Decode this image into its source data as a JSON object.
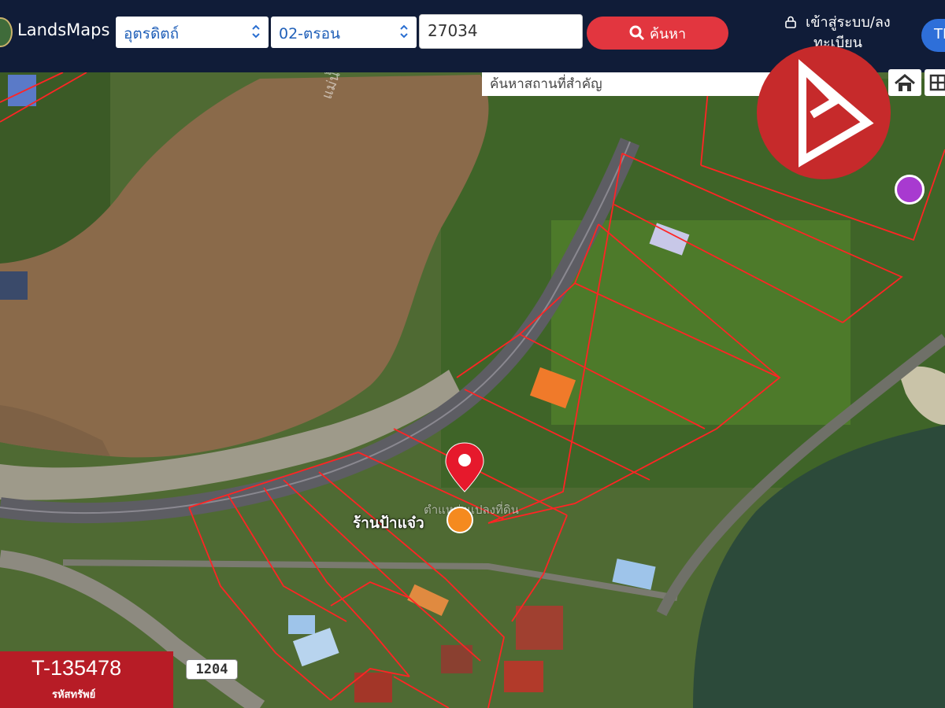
{
  "header": {
    "brand": "LandsMaps",
    "province": "อุตรดิตถ์",
    "district": "02-ตรอน",
    "parcel_number": "27034",
    "search_label": "ค้นหา",
    "login_label": "เข้าสู่ระบบ/ลงทะเบียน",
    "lang_label": "TH"
  },
  "map": {
    "poi_search_placeholder": "ค้นหาสถานที่สำคัญ",
    "clear_label": "×",
    "shop_label": "ร้านป้าแจ๋ว",
    "shop_sublabel": "ตำแหน่งแปลงที่ดิน",
    "river_label": "แม่น้ำน่าน",
    "road_number": "1204"
  },
  "listing": {
    "code": "T-135478",
    "code_caption": "รหัสทรัพย์"
  },
  "colors": {
    "header_bg": "#101c38",
    "search_red": "#e2363f",
    "parcel_line": "#ff2020",
    "badge_red": "#c62a2b",
    "lang_blue": "#2e6fd9"
  },
  "icons": [
    "search-icon",
    "lock-icon",
    "home-icon",
    "grid-icon",
    "location-pin-icon",
    "restaurant-icon",
    "place-icon",
    "brand-logo-icon"
  ]
}
